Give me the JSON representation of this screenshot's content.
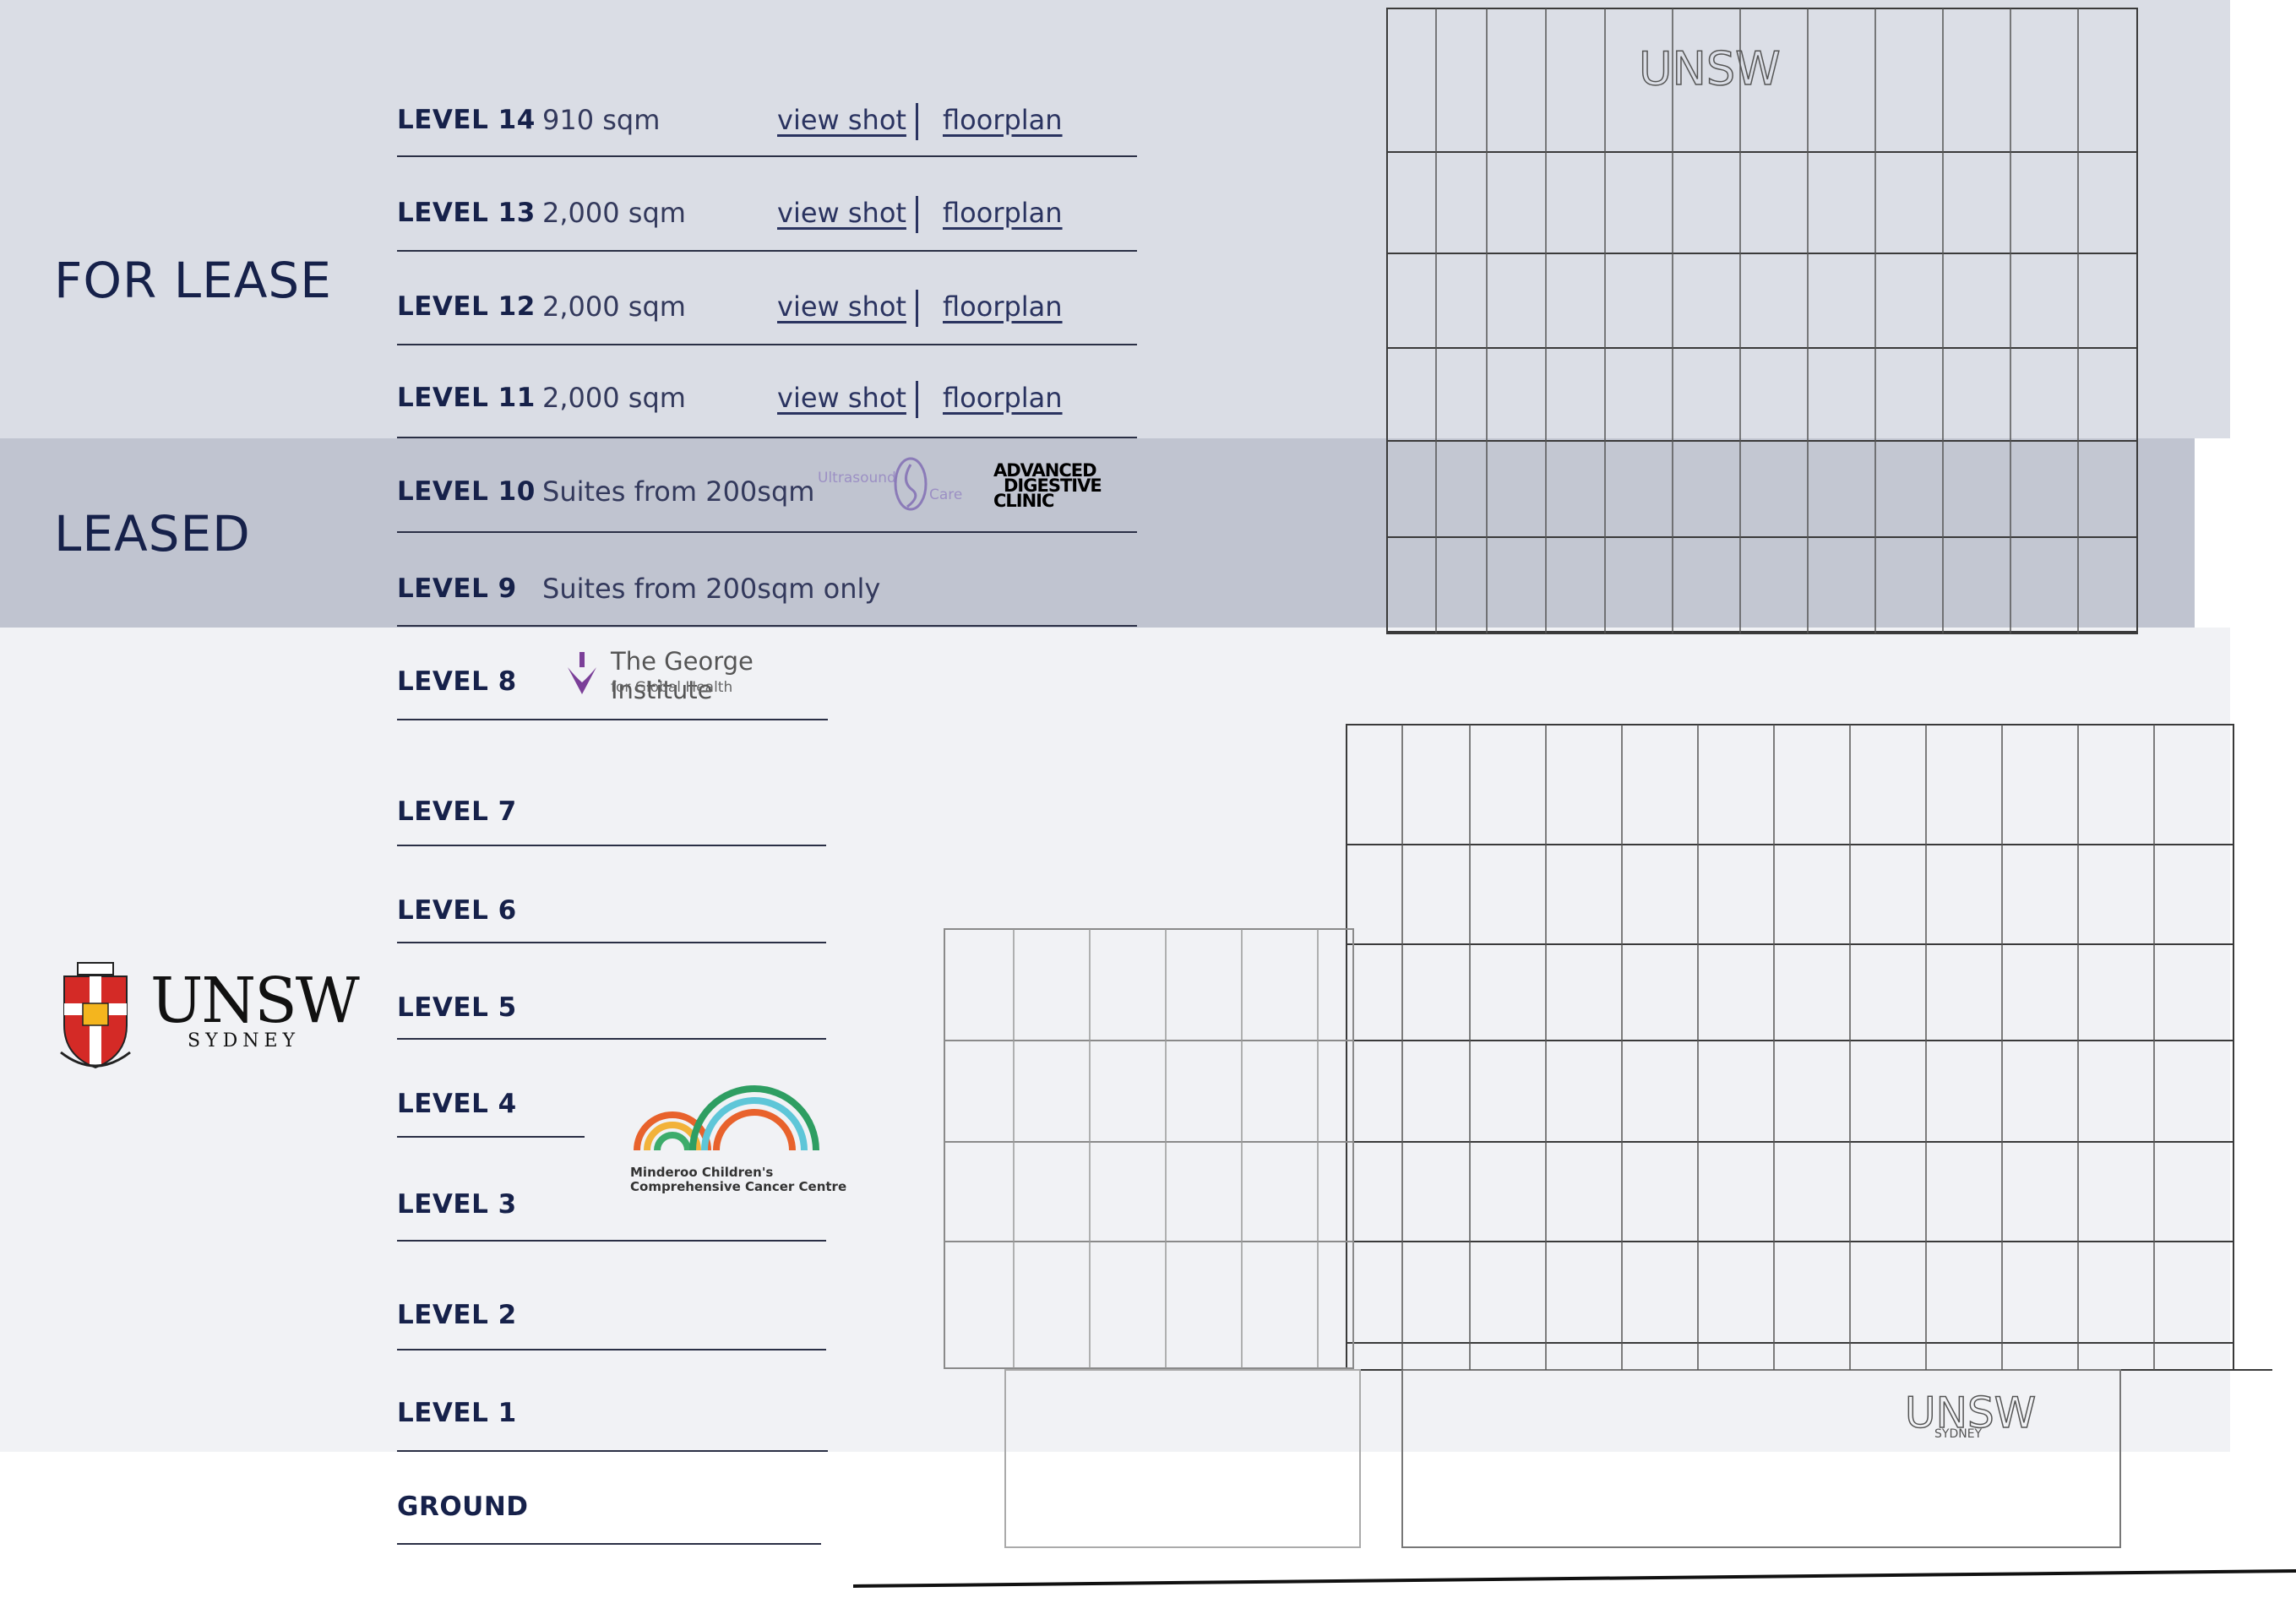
{
  "sections": {
    "for_lease": "FOR LEASE",
    "leased": "LEASED"
  },
  "levels": [
    {
      "label": "LEVEL 14",
      "area": "910 sqm",
      "view": "view shot",
      "plan": "floorplan"
    },
    {
      "label": "LEVEL 13",
      "area": "2,000 sqm",
      "view": "view shot",
      "plan": "floorplan"
    },
    {
      "label": "LEVEL 12",
      "area": "2,000 sqm",
      "view": "view shot",
      "plan": "floorplan"
    },
    {
      "label": "LEVEL 11",
      "area": "2,000 sqm",
      "view": "view shot",
      "plan": "floorplan"
    },
    {
      "label": "LEVEL 10",
      "area": "Suites from 200sqm"
    },
    {
      "label": "LEVEL 9",
      "area": "Suites from 200sqm only"
    },
    {
      "label": "LEVEL 8"
    },
    {
      "label": "LEVEL 7"
    },
    {
      "label": "LEVEL 6"
    },
    {
      "label": "LEVEL 5"
    },
    {
      "label": "LEVEL 4"
    },
    {
      "label": "LEVEL 3"
    },
    {
      "label": "LEVEL 2"
    },
    {
      "label": "LEVEL 1"
    },
    {
      "label": "GROUND"
    }
  ],
  "logos": {
    "ultrasound": {
      "left": "Ultrasound",
      "right": "Care"
    },
    "adc": {
      "line1": "ADVANCED",
      "line2": "DIGESTIVE",
      "line3": "CLINIC"
    },
    "george": {
      "name": "The George Institute",
      "sub": "for Global Health"
    },
    "unsw": {
      "name": "UNSW",
      "sub": "SYDNEY"
    },
    "minderoo": {
      "line1": "Minderoo Children's",
      "line2": "Comprehensive Cancer Centre"
    },
    "building_sign": "UNSW",
    "building_sign_sub": "SYDNEY"
  },
  "colors": {
    "navy": "#16214a",
    "for_lease_band": "#dadde5",
    "leased_band": "#c0c4d0",
    "tenants_band": "#f1f2f5",
    "ultrasound_purple": "#8b7bb8",
    "george_purple": "#7b3f98"
  }
}
